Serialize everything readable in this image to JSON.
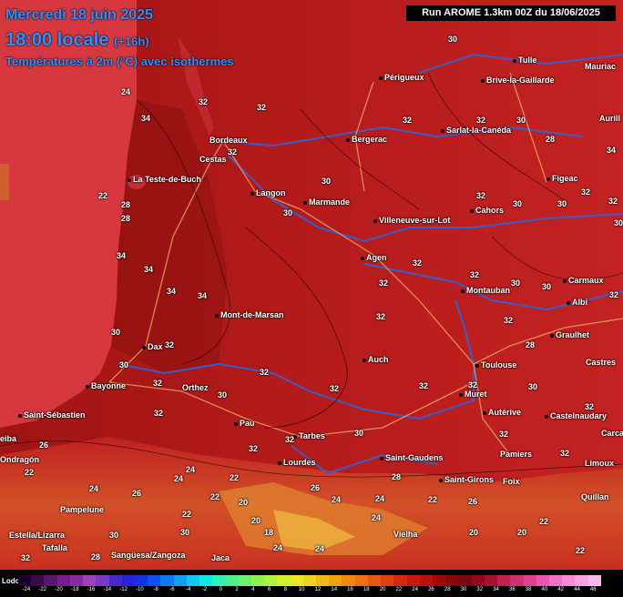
{
  "header": {
    "date": "Mercredi 18 juin 2025",
    "time": "18:00 locale",
    "offset": "(+16h)",
    "variable": "Températures à 2m (°C) avec isothermes",
    "run": "Run AROME 1.3km 00Z du 18/06/2025"
  },
  "colors": {
    "sea": "#d73840",
    "land_hot": "#b41a1a",
    "land_mid": "#c32520",
    "mountain": "#d86a28",
    "rivers": "#3a5ec8",
    "roads": "#e8a060",
    "header_text": "#2f8fff"
  },
  "cities": [
    {
      "name": "Périgueux"
    },
    {
      "name": "Tulle"
    },
    {
      "name": "Brive-la-Gaillarde"
    },
    {
      "name": "Mauriac"
    },
    {
      "name": "Aurill"
    },
    {
      "name": "Bordeaux"
    },
    {
      "name": "Bergerac"
    },
    {
      "name": "Sarlat-la-Canéda"
    },
    {
      "name": "Cestas"
    },
    {
      "name": "La Teste-de-Buch"
    },
    {
      "name": "Langon"
    },
    {
      "name": "Marmande"
    },
    {
      "name": "Figeac"
    },
    {
      "name": "Villeneuve-sur-Lot"
    },
    {
      "name": "Cahors"
    },
    {
      "name": "Agen"
    },
    {
      "name": "Carmaux"
    },
    {
      "name": "Montauban"
    },
    {
      "name": "Albi"
    },
    {
      "name": "Mont-de-Marsan"
    },
    {
      "name": "Graulhet"
    },
    {
      "name": "Dax"
    },
    {
      "name": "Castres"
    },
    {
      "name": "Auch"
    },
    {
      "name": "Toulouse"
    },
    {
      "name": "Bayonne"
    },
    {
      "name": "Orthez"
    },
    {
      "name": "Muret"
    },
    {
      "name": "Saint-Sébastien"
    },
    {
      "name": "Pau"
    },
    {
      "name": "Autérive"
    },
    {
      "name": "Castelnaudary"
    },
    {
      "name": "Tarbes"
    },
    {
      "name": "Carca"
    },
    {
      "name": "eiba"
    },
    {
      "name": "Saint-Gaudens"
    },
    {
      "name": "Pamiers"
    },
    {
      "name": "Ondragón"
    },
    {
      "name": "Lourdes"
    },
    {
      "name": "Limoux"
    },
    {
      "name": "Saint-Girons"
    },
    {
      "name": "Foix"
    },
    {
      "name": "Quillan"
    },
    {
      "name": "Pampelune"
    },
    {
      "name": "Estella/Lizarra"
    },
    {
      "name": "Vielha"
    },
    {
      "name": "Tafalla"
    },
    {
      "name": "Sangüesa/Zangoza"
    },
    {
      "name": "Jaca"
    }
  ],
  "isotherms": [
    "30",
    "24",
    "32",
    "32",
    "34",
    "32",
    "32",
    "30",
    "34",
    "28",
    "32",
    "22",
    "30",
    "30",
    "32",
    "28",
    "30",
    "30",
    "28",
    "32",
    "32",
    "32",
    "30",
    "34",
    "34",
    "34",
    "32",
    "30",
    "32",
    "34",
    "32",
    "30",
    "32",
    "30",
    "32",
    "28",
    "32",
    "30",
    "32",
    "30",
    "32",
    "32",
    "32",
    "32",
    "30",
    "30",
    "32",
    "32",
    "32",
    "32",
    "32",
    "32",
    "26",
    "22",
    "24",
    "24",
    "26",
    "22",
    "20",
    "24",
    "26",
    "22",
    "24",
    "28",
    "22",
    "24",
    "22",
    "20",
    "26",
    "18",
    "30",
    "20",
    "24",
    "20",
    "22",
    "24",
    "30",
    "28",
    "32",
    "24",
    "22"
  ],
  "legend": {
    "title": "Lodo",
    "colors": [
      "#1a0026",
      "#3a0a4a",
      "#5a1570",
      "#7a1a8c",
      "#8a2aa0",
      "#a040b8",
      "#7a3ac8",
      "#4a28c8",
      "#2a20d8",
      "#1530e8",
      "#1050f0",
      "#1078f0",
      "#10a0f0",
      "#10c8f0",
      "#10e8e0",
      "#30f0b8",
      "#50f090",
      "#70f070",
      "#90f050",
      "#b0f040",
      "#d0f030",
      "#e8e828",
      "#f0d020",
      "#f0b818",
      "#f0a010",
      "#f08810",
      "#f07010",
      "#e85810",
      "#e04010",
      "#d82810",
      "#c81810",
      "#b81010",
      "#a00808",
      "#880808",
      "#780810",
      "#900820",
      "#a81030",
      "#c02050",
      "#d03070",
      "#e04090",
      "#e858b0",
      "#f070c8",
      "#f888d8",
      "#f8a0e0",
      "#f8b8e8"
    ],
    "ticks": [
      "-24",
      "-22",
      "-20",
      "-18",
      "-16",
      "-14",
      "-12",
      "-10",
      "-8",
      "-6",
      "-4",
      "-2",
      "0",
      "2",
      "4",
      "6",
      "8",
      "10",
      "12",
      "14",
      "16",
      "18",
      "20",
      "22",
      "24",
      "26",
      "28",
      "30",
      "32",
      "34",
      "36",
      "38",
      "40",
      "42",
      "44",
      "46"
    ]
  }
}
